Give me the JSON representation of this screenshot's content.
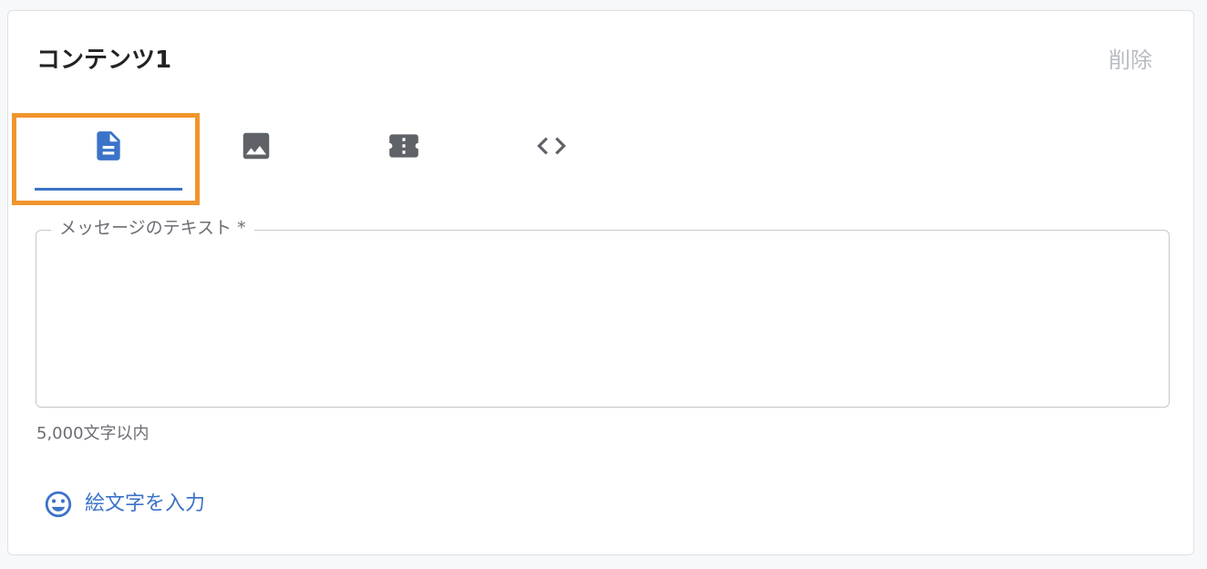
{
  "card": {
    "title": "コンテンツ1",
    "delete_label": "削除"
  },
  "tabs": [
    {
      "icon": "text-document-icon",
      "selected": true
    },
    {
      "icon": "image-icon",
      "selected": false
    },
    {
      "icon": "ticket-icon",
      "selected": false
    },
    {
      "icon": "code-icon",
      "selected": false
    }
  ],
  "message_field": {
    "label": "メッセージのテキスト *",
    "value": "",
    "hint": "5,000文字以内"
  },
  "emoji_button": {
    "icon": "smiley-face-icon",
    "label": "絵文字を入力"
  },
  "colors": {
    "accent": "#3b73c8",
    "highlight_frame": "#f0952e",
    "icon_gray": "#5f6368"
  }
}
